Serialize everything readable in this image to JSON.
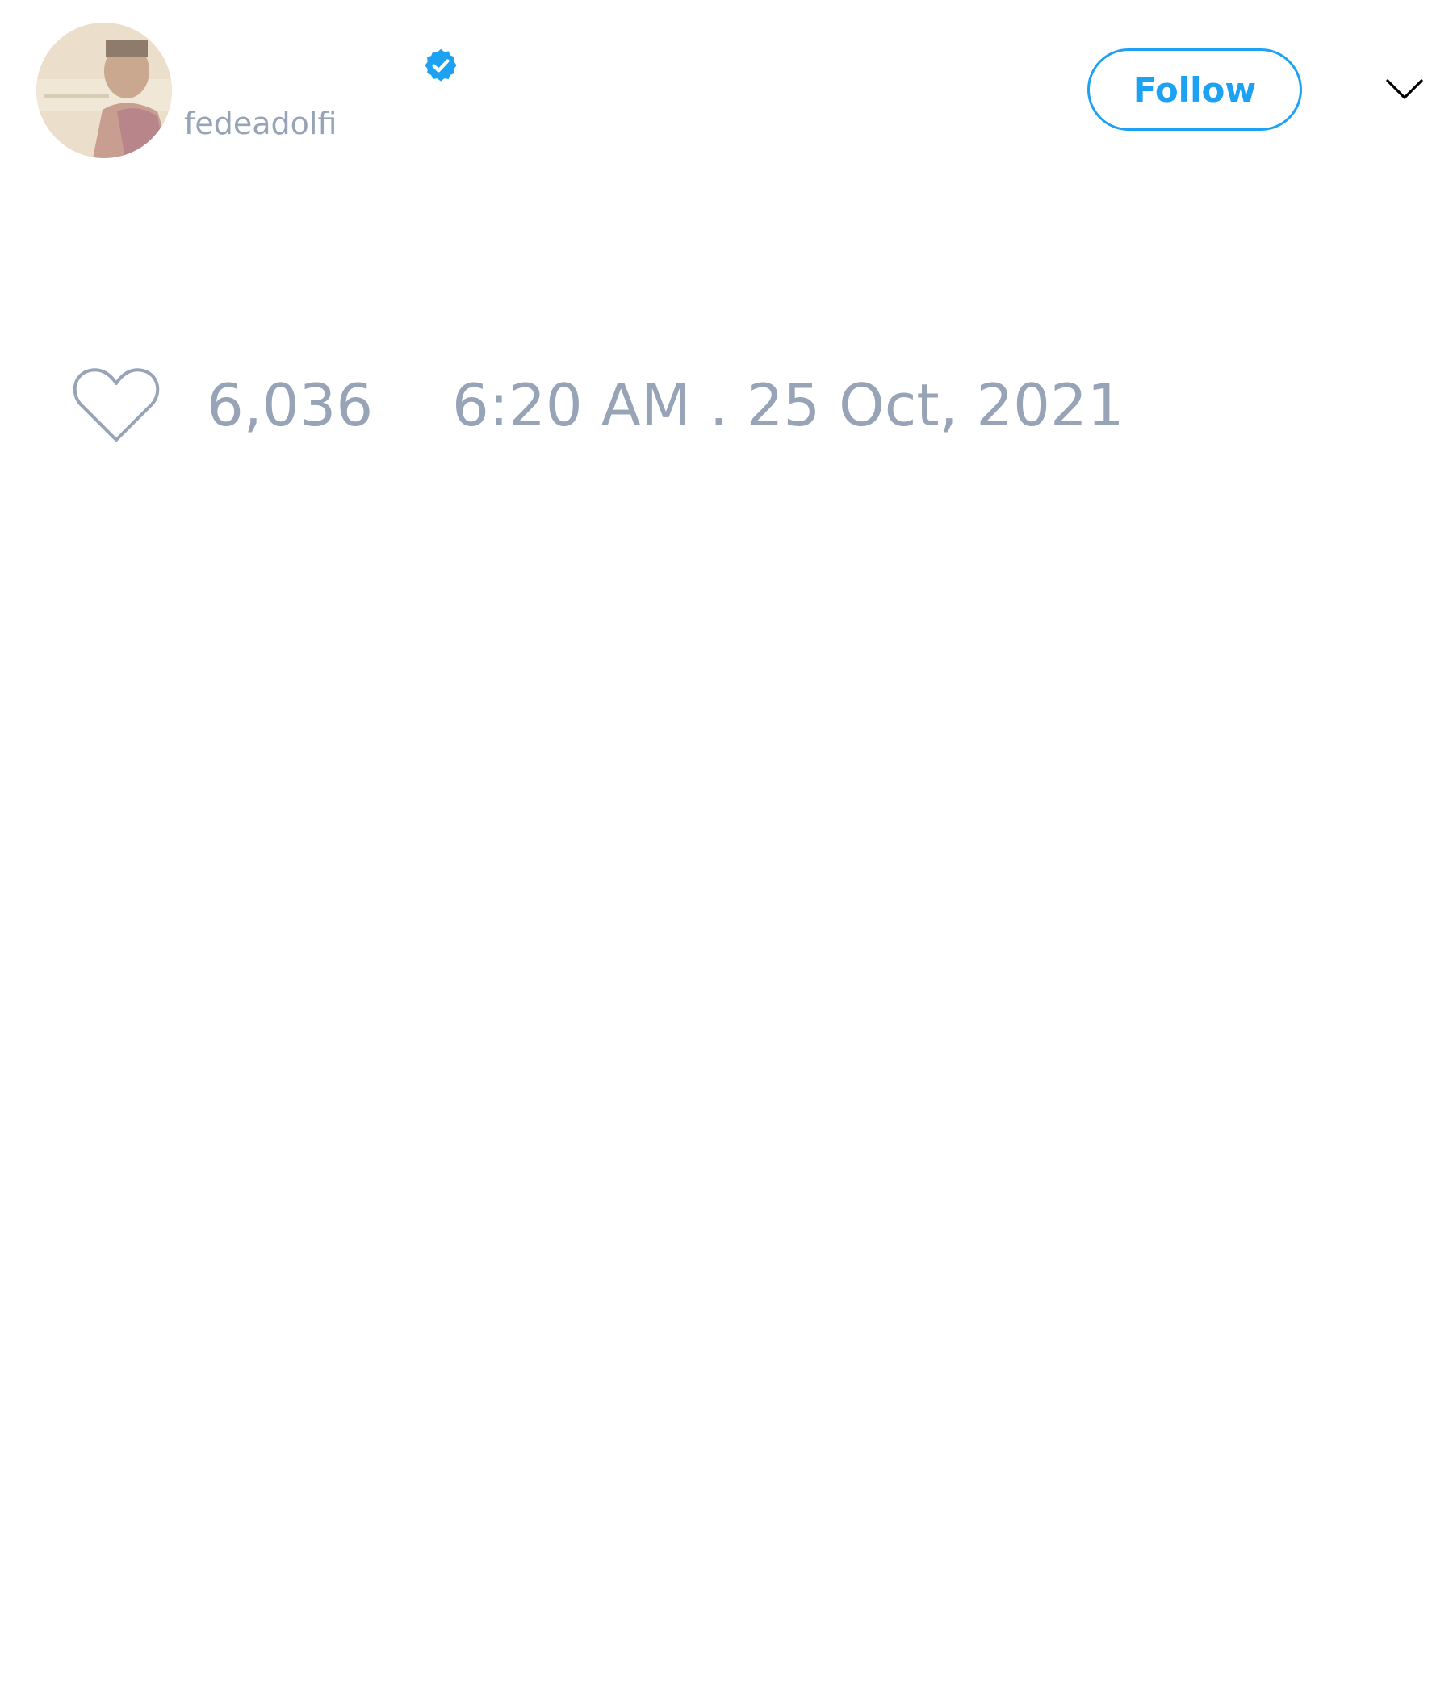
{
  "header": {
    "handle": "fedeadolfi",
    "verified_badge_icon": "verified-badge-icon",
    "follow_label": "Follow",
    "menu_icon": "chevron-down-icon"
  },
  "stats": {
    "like_icon": "heart-outline-icon",
    "likes": "6,036",
    "timestamp": "6:20 AM . 25 Oct, 2021"
  },
  "colors": {
    "accent": "#1da1f2",
    "muted_text": "#97a3b6",
    "background": "#ffffff"
  }
}
